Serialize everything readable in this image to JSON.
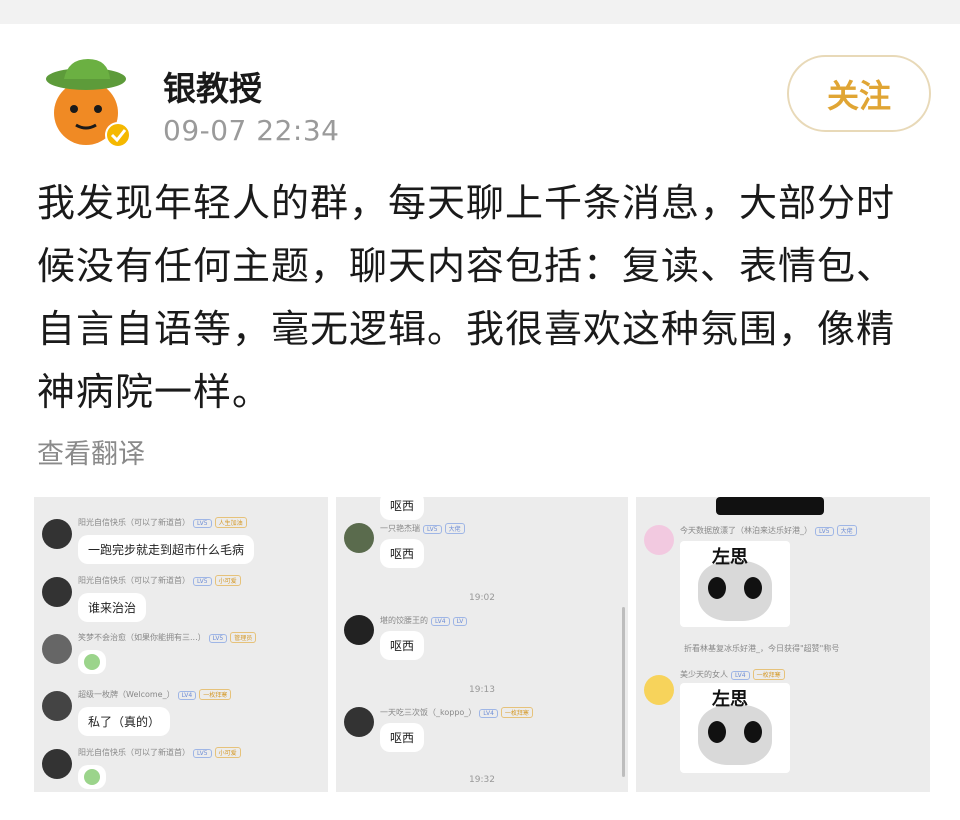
{
  "post": {
    "username": "银教授",
    "time": "09-07 22:34",
    "follow_label": "关注",
    "text_lines": [
      "我发现年轻人的群，每天聊上千条消息，大部分时",
      "候没有任何主题，聊天内容包括：复读、表情包、",
      "自言自语等，毫无逻辑。我很喜欢这种氛围，像精",
      "神病院一样。"
    ],
    "translate_label": "查看翻译"
  },
  "images": {
    "shot1": {
      "messages": [
        {
          "name": "阳光自信快乐（可以了新道首）",
          "badge1": "LV5",
          "badge2": "人生加油",
          "text": "一跑完步就走到超市什么毛病"
        },
        {
          "name": "阳光自信快乐（可以了新道首）",
          "badge1": "LV5",
          "badge2": "小可爱",
          "text": "谁来治治"
        },
        {
          "name": "笑梦不会治愈（如果你能拥有三...）",
          "badge1": "LV5",
          "badge2": "管理员",
          "text": ""
        },
        {
          "name": "超级一枚牌（Welcome_）",
          "badge1": "LV4",
          "badge2": "一枚拜寒",
          "text": "私了（真的）"
        },
        {
          "name": "阳光自信快乐（可以了新道首）",
          "badge1": "LV5",
          "badge2": "小可爱",
          "text": ""
        }
      ]
    },
    "shot2": {
      "top_text": "呕西",
      "messages": [
        {
          "name": "一只艳杰瑞",
          "badge1": "LV5",
          "badge2": "大佬",
          "text": "呕西",
          "time": "19:02"
        },
        {
          "name": "堪的饺腰王的",
          "badge1": "LV4",
          "badge2": "LV",
          "text": "呕西",
          "time": "19:13"
        },
        {
          "name": "一天吃三次饭（_koppo_）",
          "badge1": "LV4",
          "badge2": "一枚拜寒",
          "text": "呕西",
          "time": "19:32"
        }
      ]
    },
    "shot3": {
      "messages": [
        {
          "name": "今天数据放漂了（林泊来达乐好港_）",
          "badge1": "LV5",
          "badge2": "大佬",
          "sticker": "左思"
        },
        {
          "name": "美少天的女人",
          "badge1": "LV4",
          "badge2": "一枚拜寒",
          "sticker": "左思"
        }
      ],
      "system_line": "折看林基复冰乐好港_，今日获得\"超赞\"称号"
    }
  },
  "colors": {
    "follow_text": "#e0a534",
    "follow_border": "#e8d9b8",
    "time_gray": "#9a9a9a",
    "translate_gray": "#8a8a8a",
    "screenshot_bg": "#ececec"
  }
}
